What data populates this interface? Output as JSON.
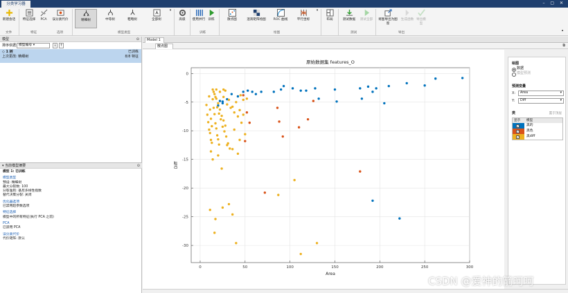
{
  "app": {
    "window_tab": "分类学习器"
  },
  "ribbon": {
    "new_session": "新建会话",
    "feature_selection": "特征选择",
    "pca": "PCA",
    "misclass_cost": "误分类代价",
    "model_tree": "精细树",
    "model_medium_tree": "中等树",
    "model_coarse_tree": "粗略树",
    "model_all_trees": "全部树",
    "advanced": "高级",
    "use_parallel": "使用并行",
    "train": "训练",
    "scatter": "散点图",
    "confusion": "混淆矩阵绘图",
    "roc": "ROC 曲线",
    "parallel_coords": "平行坐标",
    "layout": "布局",
    "test_data": "测试数据",
    "test_all": "测试全部",
    "export_plot": "将图导出为图窗",
    "generate_function": "生成函数",
    "export_model": "导出模型",
    "groups": {
      "file": "文件",
      "features": "特征",
      "options": "选项",
      "model_type": "模型类型",
      "training": "训练",
      "plots": "绘图",
      "testing": "测试",
      "export": "导出"
    }
  },
  "models_panel": {
    "title": "模型",
    "sort_label": "排序依据:",
    "sort_value": "模型编号",
    "item_name": "1 树",
    "item_status": "已训练",
    "item_last_change_label": "上次更改: 精细树",
    "item_accuracy": "8/8 特征"
  },
  "summary_panel": {
    "title": "当前模型摘要",
    "model_line": "模型 1: 已训练",
    "sec_model_type": "模型类型",
    "model_type_lines": [
      "预设: 精细树",
      "最大分裂数: 100",
      "分裂准则: 基尼多样性指数",
      "替代决策分裂: 关闭"
    ],
    "sec_optimizer": "优化器选项",
    "optimizer_lines": [
      "已禁用超参数选项"
    ],
    "sec_features": "特征选择",
    "features_lines": [
      "模型中的所有特征(执行 PCA 之前)"
    ],
    "sec_pca": "PCA",
    "pca_lines": [
      "已禁用 PCA"
    ],
    "sec_cost": "误分类代价",
    "cost_lines": [
      "代价矩阵: 默认"
    ]
  },
  "doc_tabs": {
    "model_tab": "Model 1",
    "scatter_tab": "散点图"
  },
  "plot_panel": {
    "section_plot": "绘图",
    "opt_data": "数据",
    "opt_predictions": "模型预测",
    "section_predictors": "预测变量",
    "x_label": "X:",
    "x_value": "Area",
    "y_label": "Y:",
    "y_value": "Diff",
    "section_classes": "类",
    "move_to_front": "置于顶层",
    "col_show": "显示",
    "col_class": "模型",
    "classes": [
      {
        "name": "黑的",
        "color": "#0072bd"
      },
      {
        "name": "黑色",
        "color": "#d95319"
      },
      {
        "name": "黑diff",
        "color": "#edb120"
      }
    ]
  },
  "chart_data": {
    "type": "scatter",
    "title": "原始数据集 features_O",
    "xlabel": "Area",
    "ylabel": "Diff",
    "xlim": [
      -10,
      300
    ],
    "ylim": [
      -33,
      1
    ],
    "xticks": [
      0,
      50,
      100,
      150,
      200,
      250,
      300
    ],
    "yticks": [
      0,
      -5,
      -10,
      -15,
      -20,
      -25,
      -30
    ],
    "grid": true,
    "series": [
      {
        "color": "#0072bd",
        "points": [
          [
            22,
            -4.8
          ],
          [
            25,
            -5.2
          ],
          [
            30,
            -4.5
          ],
          [
            35,
            -3.6
          ],
          [
            42,
            -4.0
          ],
          [
            48,
            -3.2
          ],
          [
            53,
            -3.0
          ],
          [
            58,
            -3.2
          ],
          [
            62,
            -3.6
          ],
          [
            68,
            -3.2
          ],
          [
            82,
            -3.2
          ],
          [
            90,
            -2.8
          ],
          [
            93,
            -2.2
          ],
          [
            103,
            -2.6
          ],
          [
            112,
            -3.0
          ],
          [
            118,
            -3.0
          ],
          [
            128,
            -2.6
          ],
          [
            132,
            -4.4
          ],
          [
            150,
            -2.8
          ],
          [
            152,
            -4.9
          ],
          [
            178,
            -2.6
          ],
          [
            180,
            -4.4
          ],
          [
            187,
            -2.3
          ],
          [
            192,
            -3.2
          ],
          [
            196,
            -2.6
          ],
          [
            205,
            -5.2
          ],
          [
            210,
            -2.2
          ],
          [
            230,
            -1.7
          ],
          [
            250,
            -2.1
          ],
          [
            262,
            -0.9
          ],
          [
            292,
            -0.8
          ],
          [
            20,
            -5.6
          ],
          [
            25,
            -4.9
          ],
          [
            192,
            -22.2
          ],
          [
            222,
            -25.3
          ]
        ]
      },
      {
        "color": "#d95319",
        "points": [
          [
            48,
            -3.8
          ],
          [
            52,
            -6.8
          ],
          [
            55,
            -8.6
          ],
          [
            50,
            -11.8
          ],
          [
            72,
            -20.8
          ],
          [
            86,
            -6.0
          ],
          [
            88,
            -8.4
          ],
          [
            92,
            -11.0
          ],
          [
            110,
            -9.4
          ],
          [
            120,
            -8.0
          ],
          [
            126,
            -4.8
          ],
          [
            178,
            -17.1
          ]
        ]
      },
      {
        "color": "#edb120",
        "points": [
          [
            7,
            -5.5
          ],
          [
            8,
            -7.2
          ],
          [
            9,
            -8.5
          ],
          [
            10,
            -9.8
          ],
          [
            11,
            -10.4
          ],
          [
            12,
            -11.6
          ],
          [
            13,
            -12.1
          ],
          [
            10,
            -4.0
          ],
          [
            11,
            -6.3
          ],
          [
            12,
            -7.9
          ],
          [
            13,
            -9.2
          ],
          [
            14,
            -4.5
          ],
          [
            15,
            -6.0
          ],
          [
            16,
            -7.1
          ],
          [
            17,
            -8.7
          ],
          [
            18,
            -9.6
          ],
          [
            19,
            -10.8
          ],
          [
            20,
            -11.5
          ],
          [
            21,
            -12.4
          ],
          [
            14,
            -2.8
          ],
          [
            16,
            -3.6
          ],
          [
            18,
            -4.4
          ],
          [
            20,
            -5.2
          ],
          [
            22,
            -6.3
          ],
          [
            24,
            -7.4
          ],
          [
            26,
            -8.2
          ],
          [
            28,
            -9.1
          ],
          [
            15,
            -3.2
          ],
          [
            17,
            -4.1
          ],
          [
            19,
            -5.9
          ],
          [
            21,
            -7.0
          ],
          [
            23,
            -8.0
          ],
          [
            25,
            -9.3
          ],
          [
            27,
            -10.1
          ],
          [
            29,
            -11.0
          ],
          [
            31,
            -12.2
          ],
          [
            33,
            -13.1
          ],
          [
            18,
            -2.8
          ],
          [
            22,
            -3.2
          ],
          [
            26,
            -4.1
          ],
          [
            30,
            -5.4
          ],
          [
            34,
            -6.0
          ],
          [
            38,
            -6.8
          ],
          [
            42,
            -7.5
          ],
          [
            46,
            -8.6
          ],
          [
            12,
            -13.6
          ],
          [
            14,
            -15.0
          ],
          [
            20,
            -14.3
          ],
          [
            24,
            -16.6
          ],
          [
            30,
            -12.5
          ],
          [
            36,
            -13.2
          ],
          [
            42,
            -14.0
          ],
          [
            28,
            -3.0
          ],
          [
            32,
            -4.6
          ],
          [
            36,
            -5.8
          ],
          [
            40,
            -5.0
          ],
          [
            44,
            -6.4
          ],
          [
            48,
            -7.2
          ],
          [
            50,
            -10.6
          ],
          [
            52,
            -4.4
          ],
          [
            38,
            -9.8
          ],
          [
            44,
            -11.6
          ],
          [
            11,
            -23.8
          ],
          [
            17,
            -25.4
          ],
          [
            25,
            -23.4
          ],
          [
            32,
            -22.8
          ],
          [
            36,
            -24.6
          ],
          [
            16,
            -27.8
          ],
          [
            40,
            -29.6
          ],
          [
            87,
            -21.2
          ],
          [
            105,
            -18.6
          ],
          [
            112,
            -31.5
          ],
          [
            130,
            -29.6
          ],
          [
            45,
            -3.8
          ],
          [
            48,
            -4.6
          ],
          [
            26,
            -2.8
          ]
        ]
      }
    ]
  },
  "statusbar": {
    "text": ""
  },
  "watermark": "CSDN @爱神的箭呵呵"
}
